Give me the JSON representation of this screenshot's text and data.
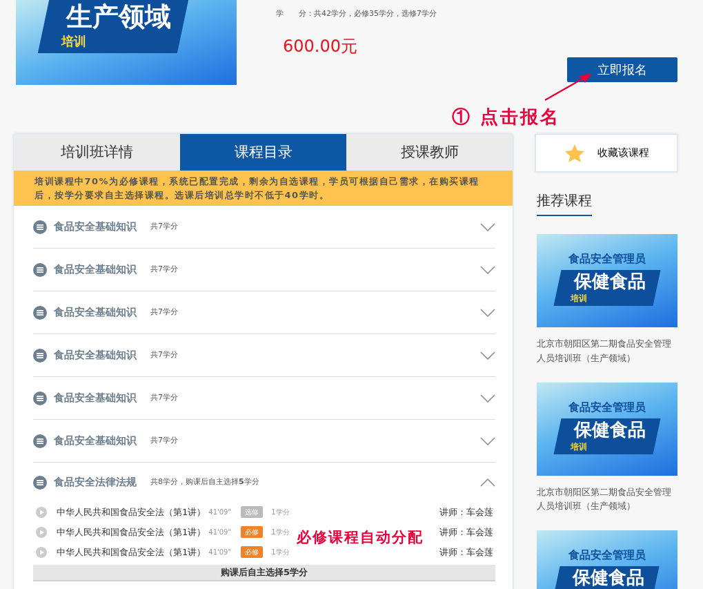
{
  "course": {
    "banner": {
      "title": "生产领域",
      "tag": "培训"
    },
    "credits_label": "学　　分",
    "credits": "：共42学分，必修35学分，选修7学分",
    "price": "600.00元",
    "enroll_button": "立即报名"
  },
  "annotations": [
    {
      "kind": "enroll",
      "text": "① 点击报名"
    },
    {
      "kind": "required",
      "text": "必修课程自动分配"
    }
  ],
  "tabs": [
    {
      "label": "培训班详情",
      "selected": false
    },
    {
      "label": "课程目录",
      "selected": true
    },
    {
      "label": "授课教师",
      "selected": false
    }
  ],
  "notice": "培训课程中**70%为必修课程**，系统已配置完成，剩余为自选课程，学员可根据自己需求，在购买课程后，**按学分要求自主选择课程**。选课后培训**总学时不低于40学时**。",
  "modules": [
    {
      "title": "食品安全基础知识",
      "credits": "共7学分",
      "expanded": false
    },
    {
      "title": "食品安全基础知识",
      "credits": "共7学分",
      "expanded": false
    },
    {
      "title": "食品安全基础知识",
      "credits": "共7学分",
      "expanded": false
    },
    {
      "title": "食品安全基础知识",
      "credits": "共7学分",
      "expanded": false
    },
    {
      "title": "食品安全基础知识",
      "credits": "共7学分",
      "expanded": false
    },
    {
      "title": "食品安全基础知识",
      "credits": "共7学分",
      "expanded": false
    },
    {
      "title": "食品安全法律法规",
      "credits": "共8学分，购课后自主选择**5**学分",
      "expanded": true,
      "lessons": [
        {
          "title": "中华人民共和国食品安全法（第1讲）",
          "duration": "41'09\"",
          "tag": "选修",
          "kind": "elective",
          "credit": "1学分",
          "teacher": "讲师：车会莲"
        },
        {
          "title": "中华人民共和国食品安全法（第1讲）",
          "duration": "41'09\"",
          "tag": "必修",
          "kind": "required",
          "credit": "1学分",
          "teacher": "讲师：车会莲"
        },
        {
          "title": "中华人民共和国食品安全法（第1讲）",
          "duration": "41'09\"",
          "tag": "必修",
          "kind": "required",
          "credit": "1学分",
          "teacher": "讲师：车会莲"
        }
      ],
      "footer": "购课后自主选择**5**学分"
    }
  ],
  "sidebar": {
    "favorite_button": "收藏该课程",
    "heading": "推荐课程",
    "recommended": [
      {
        "banner_top": "食品安全管理员",
        "banner_title": "保健食品",
        "banner_tag": "培训",
        "caption": "北京市朝阳区第二期食品安全管理人员培训班（生产领域）"
      },
      {
        "banner_top": "食品安全管理员",
        "banner_title": "保健食品",
        "banner_tag": "培训",
        "caption": "北京市朝阳区第二期食品安全管理人员培训班（生产领域）"
      },
      {
        "banner_top": "食品安全管理员",
        "banner_title": "保健食品"
      }
    ]
  }
}
